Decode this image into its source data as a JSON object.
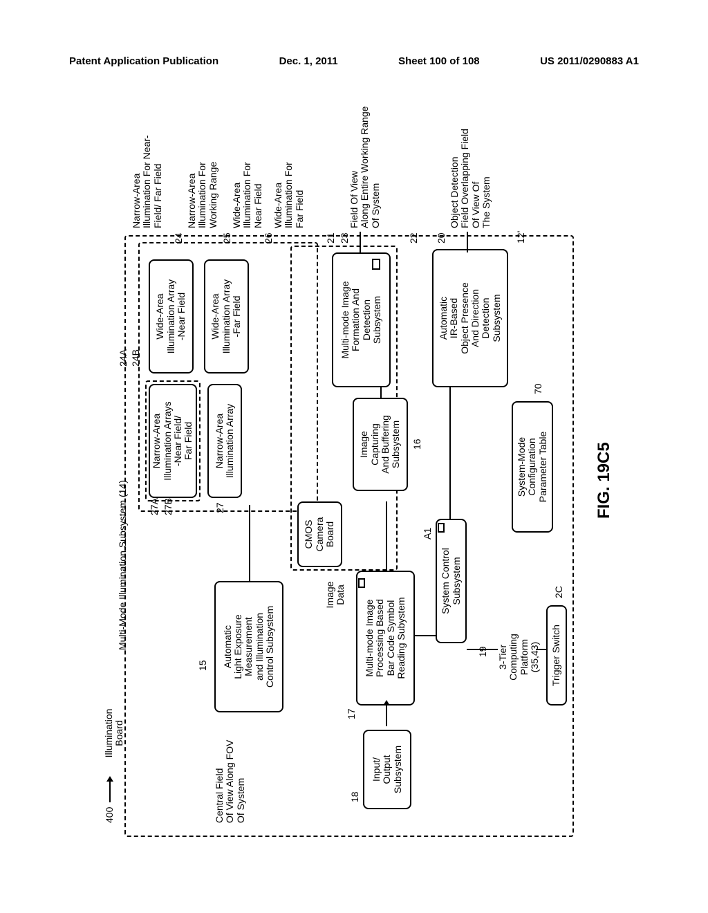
{
  "header": {
    "left": "Patent Application Publication",
    "center": "Dec. 1, 2011",
    "right_sheet": "Sheet 100 of 108",
    "right_pub": "US 2011/0290883 A1"
  },
  "figure_label": "FIG. 19C5",
  "system_ref": "400",
  "multimode_label": "Multi-Mode Illumination Subsystem (14)",
  "illumination_board_label": "Illumination\nBoard",
  "central_fov_label": "Central Field\nOf View Along FOV\nOf System",
  "boxes": {
    "narrow_near_far": "Narrow-Area\nIllumination Arrays\n-Near Field/\nFar Field",
    "narrow_ill_array": "Narrow-Area\nIllumination Array",
    "wide_near": "Wide-Area\nIllumination Array\n-Near Field",
    "wide_far": "Wide-Area\nIllumination Array\n-Far Field",
    "ale_subsystem": "Automatic\nLight Exposure\nMeasurement\nand Illumination\nControl Subsystem",
    "cmos": "CMOS\nCamera\nBoard",
    "image_data": "Image\nData",
    "mm_image_processing": "Multi-mode Image\nProcessing Based\nBar Code Symbol\nReading Subystem",
    "io_subsystem": "Input/\nOutput\nSubsystem",
    "image_capture": "Image\nCapturing\nAnd Buffering\nSubsystem",
    "system_control": "System Control\nSubsystem",
    "mm_image_formation": "Multi-mode Image\nFormation And\nDetection\nSubsystem",
    "ir_object": "Automatic\nIR-Based\nObject Presence\nAnd Direction\nDetection\nSubsystem",
    "trigger_switch": "Trigger Switch",
    "three_tier": "3-Tier\nComputing\nPlatform\n(35,43)",
    "param_table": "System-Mode\nConfiguration\nParameter Table"
  },
  "outputs": {
    "narrow_near_far": "Narrow-Area\nIllumination For Near-\nField/ Far Field",
    "narrow_working_range": "Narrow-Area\nIllumination For\nWorking Range",
    "wide_near": "Wide-Area\nIllumination For\nNear Field",
    "wide_far": "Wide-Area\nIllumination For\nFar Field",
    "fov_entire": "Field Of View\nAlong Entire Working Range\nOf System",
    "obj_detection": "Object Detection\nField Overlapping Field\nOf View Of\nThe System"
  },
  "refs": {
    "r24A": "24A",
    "r24B": "24B",
    "r27A": "27A",
    "r27B": "27B",
    "r27": "27",
    "r24": "24",
    "r25": "25",
    "r26": "26",
    "r21": "21",
    "r22": "22",
    "r23": "23",
    "r20": "20",
    "r15": "15",
    "r17": "17",
    "r18": "18",
    "r16": "16",
    "r19": "19",
    "r12p": "12'",
    "r70": "70",
    "r2C": "2C",
    "rA1": "A1"
  }
}
